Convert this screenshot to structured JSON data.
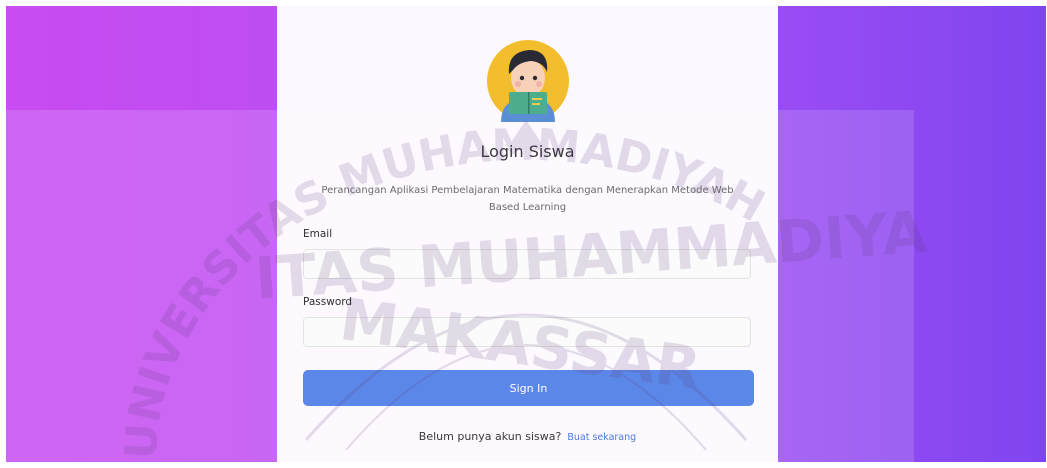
{
  "page": {
    "colors": {
      "gradient_start": "#c84cf2",
      "gradient_end": "#7f45ef",
      "card": "#ffffff",
      "button": "#5b87e8",
      "link": "#4a79e0"
    }
  },
  "login": {
    "avatar_icon": "student-reading-avatar-icon",
    "title": "Login Siswa",
    "subtitle": "Perancangan Aplikasi Pembelajaran Matematika dengan Menerapkan Metode Web Based Learning",
    "email": {
      "label": "Email",
      "value": "",
      "placeholder": ""
    },
    "password": {
      "label": "Password",
      "value": "",
      "placeholder": ""
    },
    "sign_in_label": "Sign In",
    "register_prompt": "Belum punya akun siswa?",
    "register_link": "Buat sekarang"
  },
  "watermark": {
    "line1": "ITAS MUHAMMADIYA",
    "line2": "MAKASSAR",
    "arc": "UNIVERSITAS MUHAMMADIYAH"
  }
}
